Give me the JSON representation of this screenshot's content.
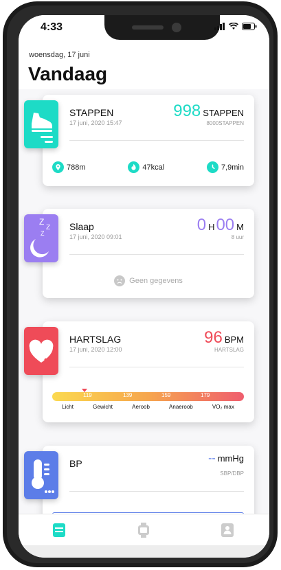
{
  "status_bar": {
    "time": "4:33"
  },
  "header": {
    "date": "woensdag, 17 juni",
    "title": "Vandaag"
  },
  "cards": {
    "steps": {
      "title": "STAPPEN",
      "timestamp": "17 juni, 2020 15:47",
      "value": "998",
      "unit": "STAPPEN",
      "goal": "8000STAPPEN",
      "accent": "#1ddbc6",
      "icon": "sneaker-icon",
      "metrics": [
        {
          "icon": "location-pin-icon",
          "value": "788m"
        },
        {
          "icon": "flame-icon",
          "value": "47kcal"
        },
        {
          "icon": "clock-icon",
          "value": "7,9min"
        }
      ]
    },
    "sleep": {
      "title": "Slaap",
      "timestamp": "17 juni, 2020 09:01",
      "hours": "0",
      "hours_unit": "H",
      "minutes": "00",
      "minutes_unit": "M",
      "goal": "8 uur",
      "accent": "#9b7ef1",
      "icon": "moon-zzz-icon",
      "no_data": "Geen gegevens"
    },
    "heart": {
      "title": "HARTSLAG",
      "timestamp": "17 juni, 2020 12:00",
      "value": "96",
      "unit": "BPM",
      "sub": "HARTSLAG",
      "accent": "#ef4b58",
      "icon": "heart-icon",
      "ticks": [
        "119",
        "139",
        "159",
        "179"
      ],
      "zones": [
        "Licht",
        "Gewicht",
        "Aeroob",
        "Anaeroob",
        "VO₂ max"
      ]
    },
    "bp": {
      "title": "BP",
      "value": "--",
      "unit": "mmHg",
      "sub": "SBP/DBP",
      "accent": "#5c7de8",
      "icon": "thermometer-icon"
    }
  },
  "tabs": [
    {
      "name": "today",
      "icon": "today-tab-icon",
      "active_color": "#1ddbc6"
    },
    {
      "name": "device",
      "icon": "watch-tab-icon",
      "color": "#cccccc"
    },
    {
      "name": "profile",
      "icon": "profile-tab-icon",
      "color": "#cccccc"
    }
  ]
}
